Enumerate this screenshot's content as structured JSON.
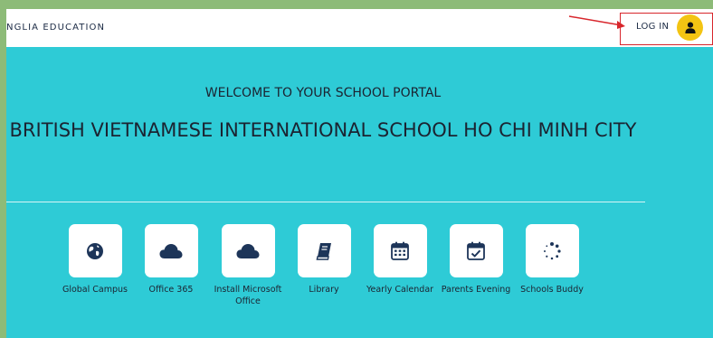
{
  "header": {
    "brand": "NGLIA EDUCATION",
    "login_label": "LOG IN",
    "avatar_icon": "user-icon",
    "accent_color": "#f3c413"
  },
  "hero": {
    "welcome": "WELCOME TO YOUR SCHOOL PORTAL",
    "school_name": "BRITISH VIETNAMESE INTERNATIONAL SCHOOL HO CHI MINH CITY",
    "background_color": "#2ecbd6"
  },
  "tiles": [
    {
      "label": "Global Campus",
      "icon": "globe-icon"
    },
    {
      "label": "Office 365",
      "icon": "cloud-icon"
    },
    {
      "label": "Install Microsoft Office",
      "icon": "cloud-icon"
    },
    {
      "label": "Library",
      "icon": "book-icon"
    },
    {
      "label": "Yearly Calendar",
      "icon": "calendar-grid-icon"
    },
    {
      "label": "Parents Evening",
      "icon": "calendar-check-icon"
    },
    {
      "label": "Schools Buddy",
      "icon": "spinner-icon"
    }
  ]
}
